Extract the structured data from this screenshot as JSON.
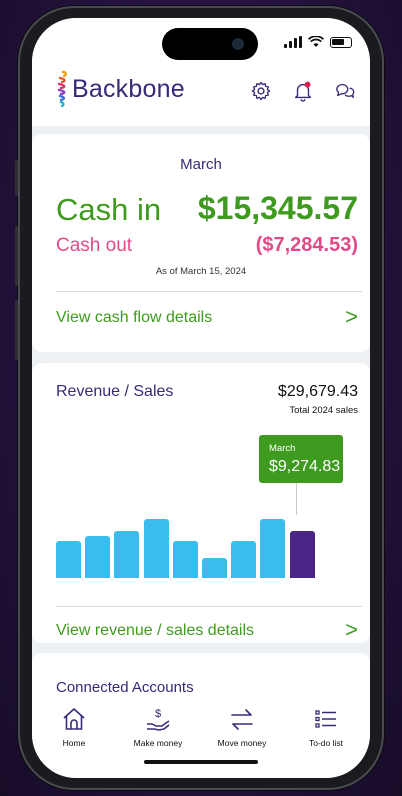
{
  "header": {
    "brand": "Backbone",
    "icons": [
      "gear-icon",
      "bell-icon",
      "chat-icon"
    ],
    "notification_dot_color": "#e8194b"
  },
  "cash_card": {
    "month": "March",
    "cash_in_label": "Cash in",
    "cash_in_value": "$15,345.57",
    "cash_out_label": "Cash out",
    "cash_out_value": "($7,284.53)",
    "as_of": "As of March 15, 2024",
    "details_link": "View cash flow details",
    "chevron": ">"
  },
  "revenue_card": {
    "title": "Revenue / Sales",
    "total": "$29,679.43",
    "total_caption": "Total 2024 sales",
    "tooltip_month": "March",
    "tooltip_value": "$9,274.83",
    "details_link": "View revenue / sales details",
    "chevron": ">",
    "colors": {
      "bar": "#3bbcef",
      "selected": "#4a2585",
      "accent": "#3f9b1f"
    }
  },
  "chart_data": {
    "type": "bar",
    "values": [
      40,
      45,
      51,
      64,
      40,
      22,
      40,
      64,
      51
    ],
    "selected_index": 8,
    "ylim": [
      0,
      70
    ],
    "xlabel": "",
    "ylabel": ""
  },
  "connected": {
    "title": "Connected Accounts"
  },
  "tabs": [
    {
      "label": "Home",
      "icon": "home-icon"
    },
    {
      "label": "Make money",
      "icon": "money-hand-icon"
    },
    {
      "label": "Move money",
      "icon": "transfer-arrows-icon"
    },
    {
      "label": "To-do list",
      "icon": "list-icon"
    }
  ]
}
